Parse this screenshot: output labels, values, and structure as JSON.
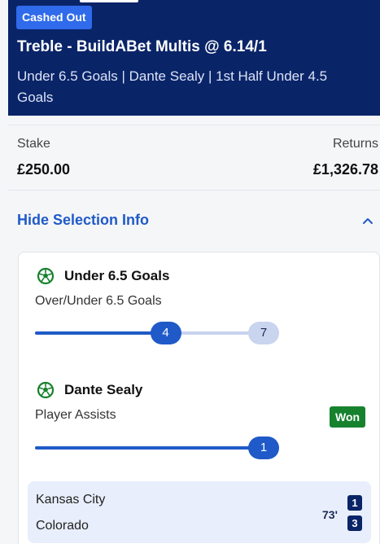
{
  "bet": {
    "status_badge": "Cashed Out",
    "title": "Treble - BuildABet Multis @ 6.14/1",
    "legs_summary": "Under 6.5 Goals | Dante Sealy | 1st Half Under 4.5 Goals"
  },
  "summary": {
    "stake_label": "Stake",
    "stake_value": "£250.00",
    "returns_label": "Returns",
    "returns_value": "£1,326.78"
  },
  "selection_toggle": {
    "label": "Hide Selection Info",
    "icon": "chevron-up-icon"
  },
  "selections": [
    {
      "icon": "football-icon",
      "name": "Under 6.5 Goals",
      "market": "Over/Under 6.5 Goals",
      "current": "4",
      "target": "7",
      "progress_fraction": 0.5714
    },
    {
      "icon": "football-icon",
      "name": "Dante Sealy",
      "market": "Player Assists",
      "result": "Won",
      "current": "1",
      "progress_fraction": 1.0
    }
  ],
  "match": {
    "home_team": "Kansas City",
    "away_team": "Colorado",
    "minute": "73'",
    "home_score": "1",
    "away_score": "3"
  },
  "colors": {
    "header_bg": "#0a2468",
    "badge_bg": "#2f6bea",
    "accent": "#1f5ac8",
    "won": "#16822e"
  }
}
